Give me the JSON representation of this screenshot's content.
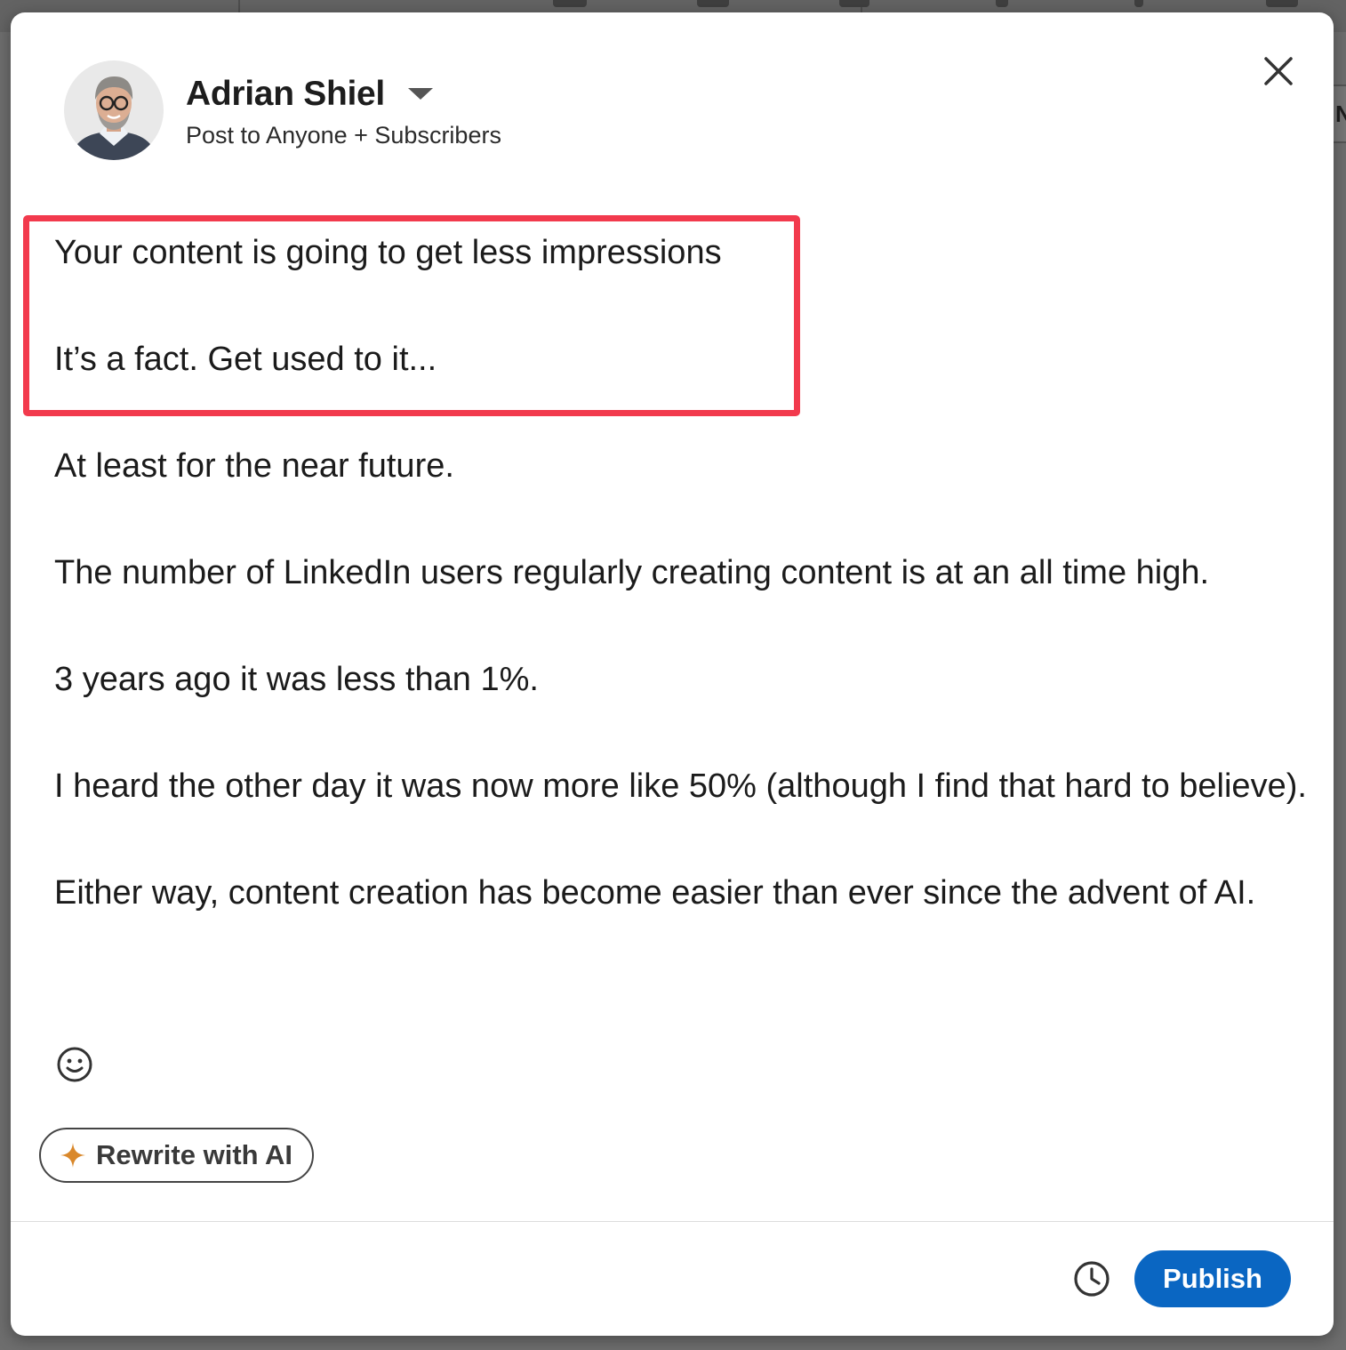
{
  "author": {
    "name": "Adrian Shiel",
    "audience": "Post to Anyone + Subscribers"
  },
  "post": {
    "paragraphs": [
      "Your content is going to get less impressions",
      "It’s a fact. Get used to it...",
      "At least for the near future.",
      "The number of LinkedIn users regularly creating content is at an all time high.",
      "3 years ago it was less than 1%.",
      "I heard the other day it was now more like 50% (although I find that hard to believe).",
      "Either way, content creation has become easier than ever since the advent of AI."
    ]
  },
  "actions": {
    "rewrite_label": "Rewrite with AI",
    "publish_label": "Publish"
  },
  "icons": {
    "close": "close-icon",
    "caret": "chevron-down-icon",
    "emoji": "smiley-icon",
    "sparkle": "sparkle-icon",
    "schedule": "clock-icon"
  },
  "colors": {
    "primary": "#0a66c2",
    "highlight": "#f23a4d",
    "sparkle": "#d9882b"
  }
}
